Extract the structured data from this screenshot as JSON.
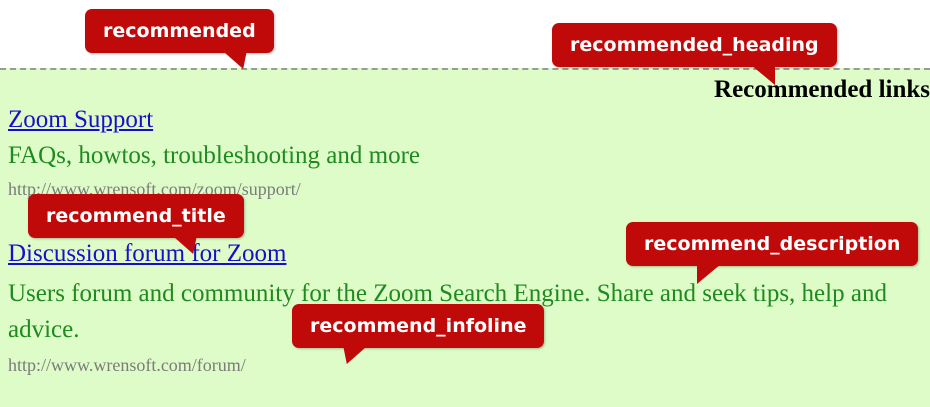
{
  "recommended": {
    "heading": "Recommended links",
    "items": [
      {
        "title": "Zoom Support",
        "description": "FAQs, howtos, troubleshooting and more",
        "infoline": "http://www.wrensoft.com/zoom/support/"
      },
      {
        "title": "Discussion forum for Zoom",
        "description": "Users forum and community for the Zoom Search Engine. Share and seek tips, help and advice.",
        "infoline": "http://www.wrensoft.com/forum/"
      }
    ]
  },
  "callouts": {
    "recommended": "recommended",
    "recommended_heading": "recommended_heading",
    "recommend_title": "recommend_title",
    "recommend_description": "recommend_description",
    "recommend_infoline": "recommend_infoline"
  },
  "colors": {
    "callout_bg": "#c00a0a",
    "panel_bg": "#ddfcc7",
    "link": "#1a0dcc",
    "description": "#1f8a1f",
    "infoline": "#7b7b7b"
  }
}
